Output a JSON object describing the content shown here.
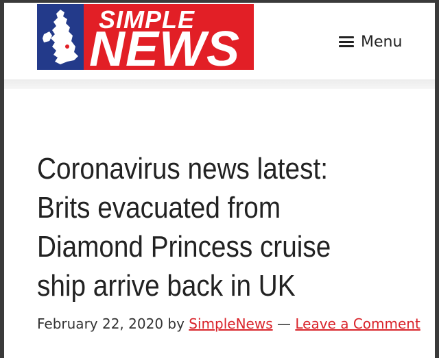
{
  "colors": {
    "brand_red": "#e21f26",
    "brand_blue": "#233a8a",
    "link_red": "#d9232a",
    "text_dark": "#222222"
  },
  "header": {
    "logo": {
      "line1": "SIMPLE",
      "line2": "NEWS",
      "map_icon": "uk-map-icon"
    },
    "menu": {
      "icon": "hamburger-icon",
      "label": "Menu"
    }
  },
  "article": {
    "title": "Coronavirus news latest: Brits evacuated from Diamond Princess cruise ship arrive back in UK",
    "date": "February 22, 2020",
    "by_label": "by",
    "author": "SimpleNews",
    "separator": "—",
    "comment_link": "Leave a Comment"
  }
}
